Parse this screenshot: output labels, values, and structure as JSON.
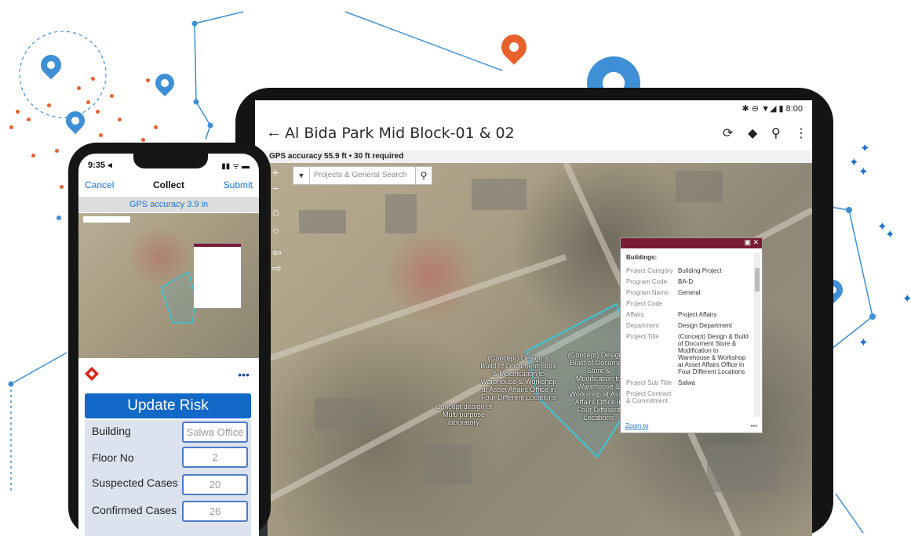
{
  "tablet": {
    "status_text": "✱ ⊖ ▼◢ ▮ 8:00",
    "back_icon": "back-arrow-icon",
    "title": "Al Bida Park Mid Block-01 & 02",
    "toolbar_icons": [
      "sync-icon",
      "layers-icon",
      "search-icon",
      "more-vert-icon"
    ],
    "gps_text": "GPS accuracy 55.9 ft  •  30 ft required",
    "search_placeholder": "Projects & General Search",
    "map_tools": [
      "zoom-in-icon",
      "zoom-out-icon",
      "home-icon",
      "locate-icon",
      "back-icon",
      "forward-icon"
    ],
    "map_labels": [
      "(Concept) Design & Build of Document Store & Modification to Warehouse & Workshop at Asset Affairs Office in Four Different Locations",
      "Concept design of Multi purpose laboratory",
      "(Concept) Design & Build of Document Store & Modification to Warehouse & Workshop at Asset Affairs Office in Four Different Locations"
    ],
    "popup": {
      "title": "Buildings:",
      "rows": [
        {
          "key": "Project Category",
          "value": "Building Project"
        },
        {
          "key": "Program Code",
          "value": "BA-D"
        },
        {
          "key": "Program Name",
          "value": "General"
        },
        {
          "key": "Project Code",
          "value": ""
        },
        {
          "key": "Affairs",
          "value": "Project Affairs"
        },
        {
          "key": "Department",
          "value": "Design Department"
        },
        {
          "key": "Project Title",
          "value": "(Concept) Design & Build of Document Store & Modification to Warehouse & Workshop at Asset Affairs Office in Four Different Locations"
        },
        {
          "key": "Project Sub Title",
          "value": "Salwa"
        },
        {
          "key": "Project Contract & Commitment",
          "value": ""
        }
      ],
      "zoom_label": "Zoom to",
      "more_label": "•••"
    }
  },
  "phone": {
    "time": "9:35 ◂",
    "status": "▮▮ ᯤ ▬",
    "cancel": "Cancel",
    "title": "Collect",
    "submit": "Submit",
    "gps": "GPS accuracy 3.9 in",
    "update_risk": "Update Risk",
    "more": "•••",
    "fields": [
      {
        "label": "Building",
        "value": "Salwa Office"
      },
      {
        "label": "Floor No",
        "value": "2"
      },
      {
        "label": "Suspected Cases",
        "value": "20"
      },
      {
        "label": "Confirmed Cases",
        "value": "26"
      }
    ]
  },
  "colors": {
    "accent_blue": "#1168c7",
    "popup_header": "#7a1c35",
    "pin_blue": "#3e8fd6",
    "pin_orange": "#e8612c"
  }
}
